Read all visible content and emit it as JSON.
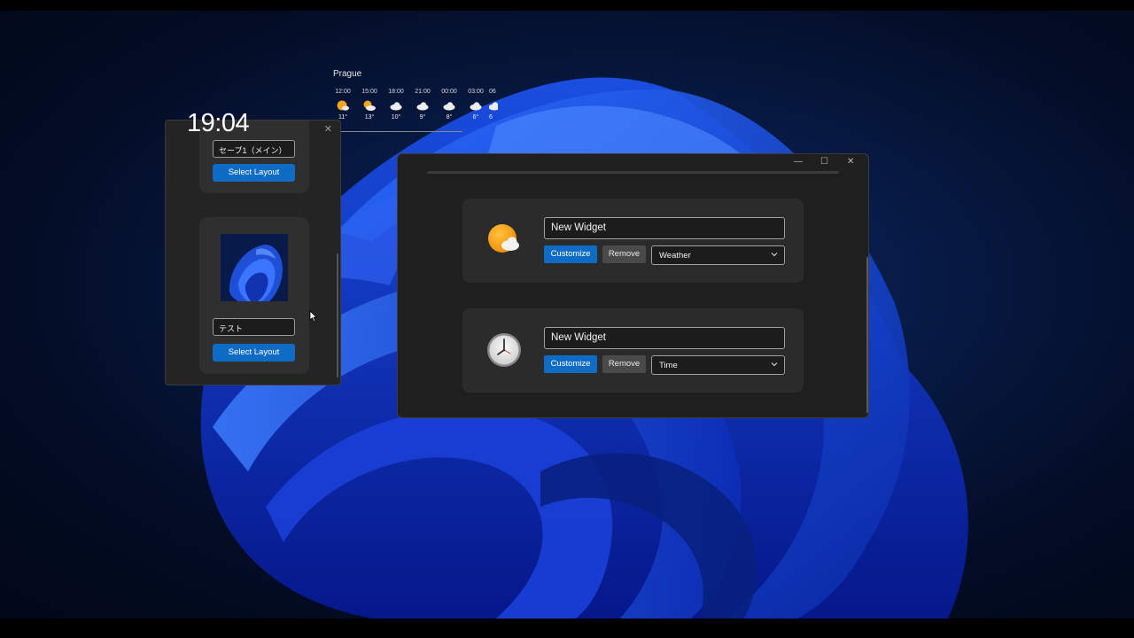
{
  "weather": {
    "city": "Prague",
    "forecast": [
      {
        "time": "12:00",
        "temp": "11°",
        "icon": "sunny-icon"
      },
      {
        "time": "15:00",
        "temp": "13°",
        "icon": "partly-cloudy-icon"
      },
      {
        "time": "18:00",
        "temp": "10°",
        "icon": "cloud-icon"
      },
      {
        "time": "21:00",
        "temp": "9°",
        "icon": "cloud-icon"
      },
      {
        "time": "00:00",
        "temp": "8°",
        "icon": "cloud-icon"
      },
      {
        "time": "03:00",
        "temp": "6°",
        "icon": "cloud-icon"
      },
      {
        "time": "06",
        "temp": "6",
        "icon": "cloud-icon"
      }
    ]
  },
  "clock": {
    "time": "19:04"
  },
  "layout_panel": {
    "close_glyph": "✕",
    "layouts": [
      {
        "name": "セーブ1（メイン）",
        "select_label": "Select Layout"
      },
      {
        "name": "テスト",
        "select_label": "Select Layout"
      }
    ]
  },
  "settings_window": {
    "controls": {
      "minimize": "—",
      "maximize": "☐",
      "close": "✕"
    },
    "widgets": [
      {
        "name": "New Widget",
        "customize_label": "Customize",
        "remove_label": "Remove",
        "type": "Weather",
        "icon": "weather-icon"
      },
      {
        "name": "New Widget",
        "customize_label": "Customize",
        "remove_label": "Remove",
        "type": "Time",
        "icon": "clock-icon"
      }
    ]
  },
  "colors": {
    "accent": "#0f6cc4",
    "window_bg": "#1f1f1f",
    "card_bg": "#2b2b2b"
  }
}
